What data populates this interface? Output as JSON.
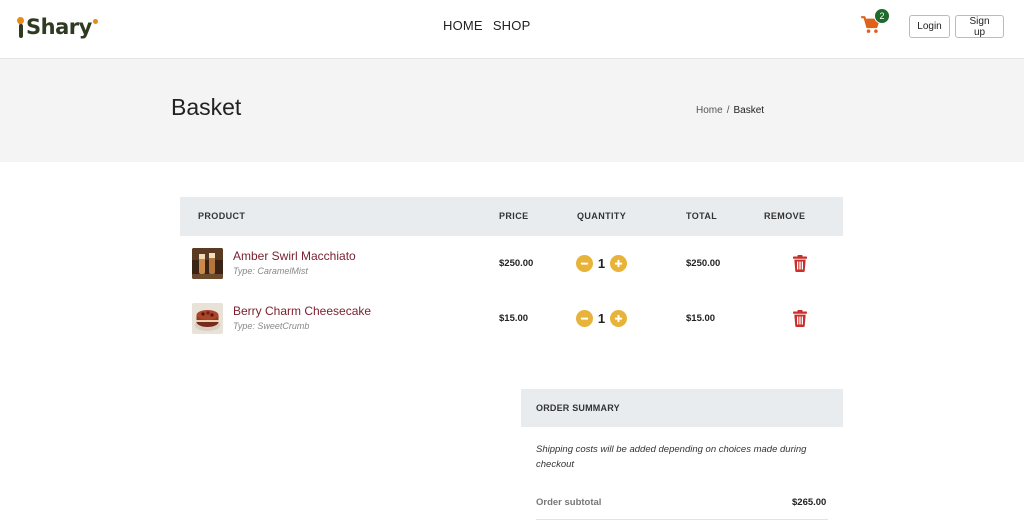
{
  "header": {
    "logo_text": "Shary",
    "nav": [
      "HOME",
      "SHOP"
    ],
    "cart_count": "2",
    "login_label": "Login",
    "signup_label": "Sign up"
  },
  "banner": {
    "title": "Basket",
    "breadcrumb": {
      "home": "Home",
      "separator": "/",
      "current": "Basket"
    }
  },
  "table": {
    "headers": {
      "product": "PRODUCT",
      "price": "PRICE",
      "quantity": "QUANTITY",
      "total": "TOTAL",
      "remove": "REMOVE"
    },
    "rows": [
      {
        "name": "Amber Swirl Macchiato",
        "type": "Type: CaramelMist",
        "price": "$250.00",
        "quantity": "1",
        "total": "$250.00"
      },
      {
        "name": "Berry Charm Cheesecake",
        "type": "Type: SweetCrumb",
        "price": "$15.00",
        "quantity": "1",
        "total": "$15.00"
      }
    ]
  },
  "summary": {
    "title": "ORDER SUMMARY",
    "note": "Shipping costs will be added depending on choices made during checkout",
    "subtotal_label": "Order subtotal",
    "subtotal_value": "$265.00"
  },
  "colors": {
    "accent_orange": "#e0621a",
    "quantity_button": "#e8b33a",
    "remove_red": "#c9302c",
    "badge_green": "#1e6b2b",
    "product_name": "#7a2231"
  }
}
